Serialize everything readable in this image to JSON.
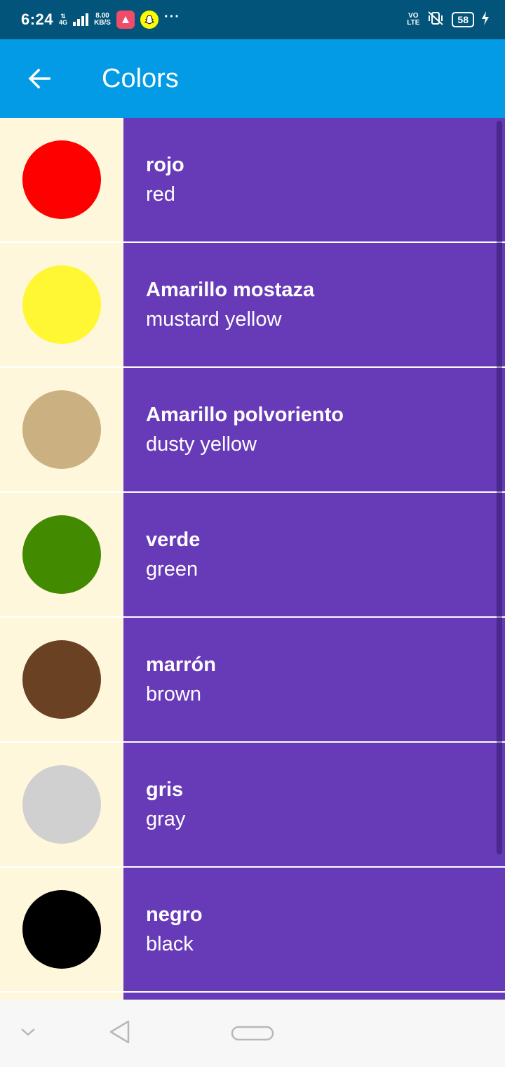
{
  "status_bar": {
    "time": "6:24",
    "network": "4G",
    "speed_value": "8.00",
    "speed_unit": "KB/S",
    "overflow": "···",
    "volte": "VO\nLTE",
    "battery": "58",
    "icons": [
      "signal-icon",
      "app-notification-icon",
      "snapchat-icon",
      "vibrate-off-icon",
      "battery-icon",
      "charging-icon"
    ]
  },
  "app_bar": {
    "title": "Colors",
    "back_icon": "arrow-back-icon",
    "background": "#039be5"
  },
  "colors": [
    {
      "spanish": "rojo",
      "english": "red",
      "swatch": "#ff0000"
    },
    {
      "spanish": "Amarillo mostaza",
      "english": "mustard yellow",
      "swatch": "#fff733"
    },
    {
      "spanish": "Amarillo polvoriento",
      "english": "dusty yellow",
      "swatch": "#cbb082"
    },
    {
      "spanish": "verde",
      "english": "green",
      "swatch": "#428a00"
    },
    {
      "spanish": "marrón",
      "english": "brown",
      "swatch": "#6b4123"
    },
    {
      "spanish": "gris",
      "english": "gray",
      "swatch": "#d0d0d0"
    },
    {
      "spanish": "negro",
      "english": "black",
      "swatch": "#000000"
    }
  ],
  "theme": {
    "text_panel": "#673ab7",
    "swatch_panel": "#fff7dc",
    "status_bar": "#02547a"
  },
  "nav_bar": {
    "icons": [
      "chevron-down-icon",
      "back-triangle-icon",
      "home-pill-icon"
    ]
  }
}
